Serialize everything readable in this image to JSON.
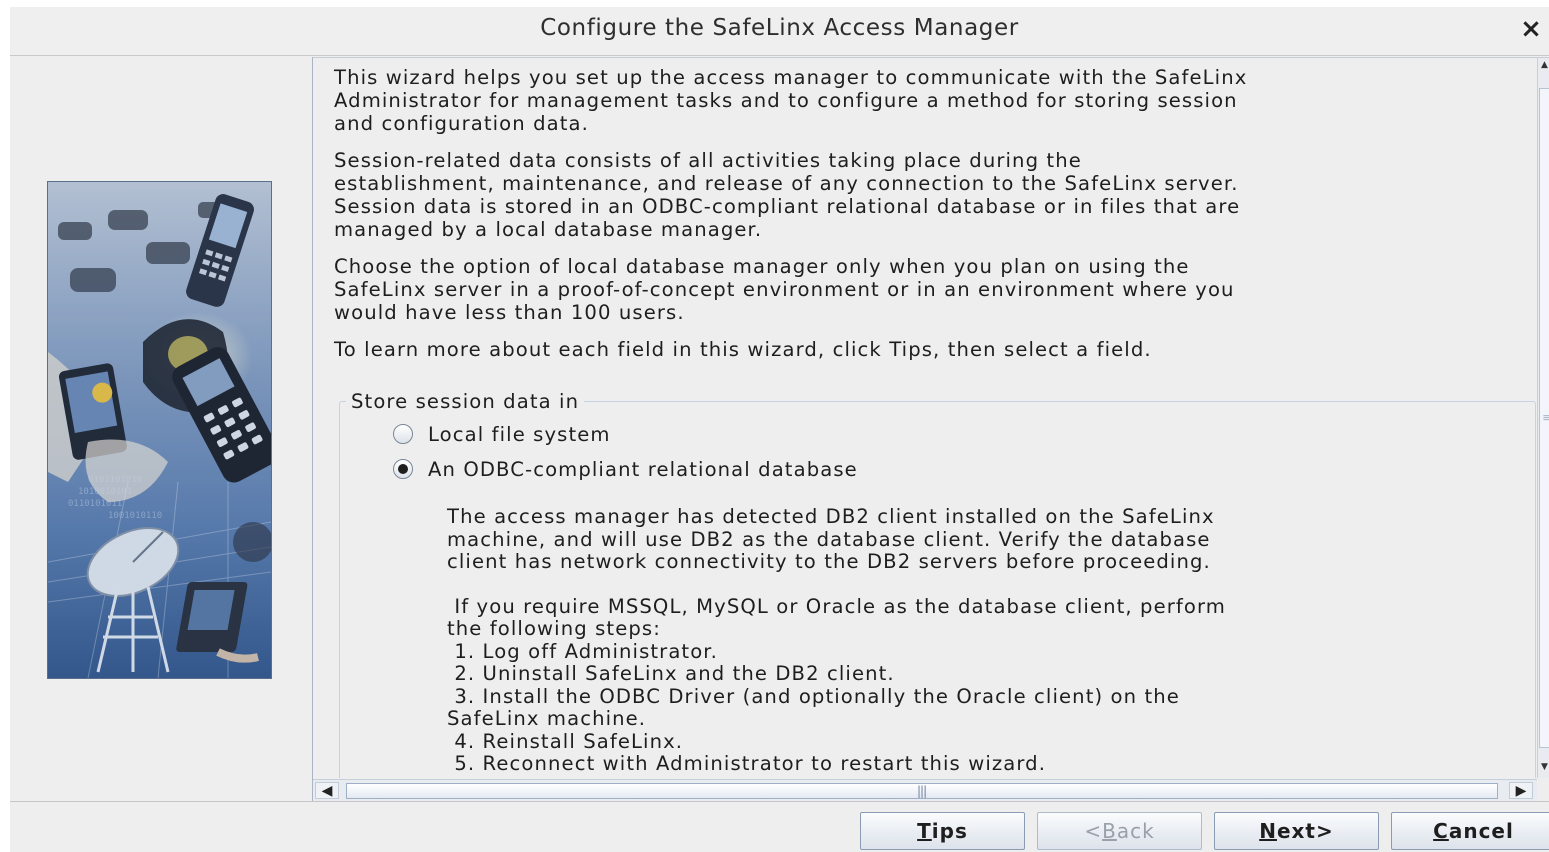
{
  "dialog": {
    "title": "Configure the SafeLinx Access Manager",
    "close_glyph": "×"
  },
  "intro": {
    "p1": [
      "This wizard helps you set up the access manager to communicate with the SafeLinx",
      "Administrator for management tasks and to configure a method for storing session",
      "and configuration data."
    ],
    "p2": [
      "Session-related data consists of all activities taking place during the",
      "establishment, maintenance, and release of any connection to the SafeLinx server.",
      "Session data is stored in an ODBC-compliant relational database or in files that are",
      "managed by a local database manager."
    ],
    "p3": [
      "Choose the option of local database manager only when you plan on using the",
      "SafeLinx server in a proof-of-concept environment or in an environment where you",
      "would have less than 100 users."
    ],
    "p4": "To learn more about each field in this wizard, click Tips, then select a field."
  },
  "storage": {
    "legend": "Store session data in",
    "options": [
      {
        "label": "Local file system",
        "selected": false
      },
      {
        "label": "An ODBC-compliant relational database",
        "selected": true
      }
    ],
    "detected": [
      "The access manager has detected DB2 client installed on the SafeLinx",
      "machine, and will use DB2 as the database client. Verify the database",
      "client has network connectivity to the DB2 servers before proceeding."
    ],
    "steps": [
      " If you require MSSQL, MySQL or Oracle as the database client, perform",
      "the following steps:",
      " 1. Log off Administrator.",
      " 2. Uninstall SafeLinx and the DB2 client.",
      " 3. Install the ODBC Driver (and optionally the Oracle client) on the",
      "SafeLinx machine.",
      " 4. Reinstall SafeLinx.",
      " 5. Reconnect with Administrator to restart this wizard."
    ]
  },
  "scrollbars": {
    "left_arrow": "◀",
    "right_arrow": "▶",
    "up_arrow": "▲",
    "down_arrow": "▼"
  },
  "buttons": {
    "tips": {
      "prefix": "",
      "mnemonic": "T",
      "rest": "ips",
      "enabled": true
    },
    "back": {
      "prefix": "<",
      "mnemonic": "B",
      "rest": "ack",
      "enabled": false
    },
    "next": {
      "prefix": "",
      "mnemonic": "N",
      "rest": "ext>",
      "enabled": true
    },
    "cancel": {
      "prefix": "",
      "mnemonic": "C",
      "rest": "ancel",
      "enabled": true
    }
  },
  "icons": {
    "close": "close-icon",
    "wizard_art": "mobile-devices-illustration"
  },
  "colors": {
    "dialog_bg": "#eeeeee",
    "border": "#a9b5c7",
    "button_border": "#8a9bb3"
  }
}
